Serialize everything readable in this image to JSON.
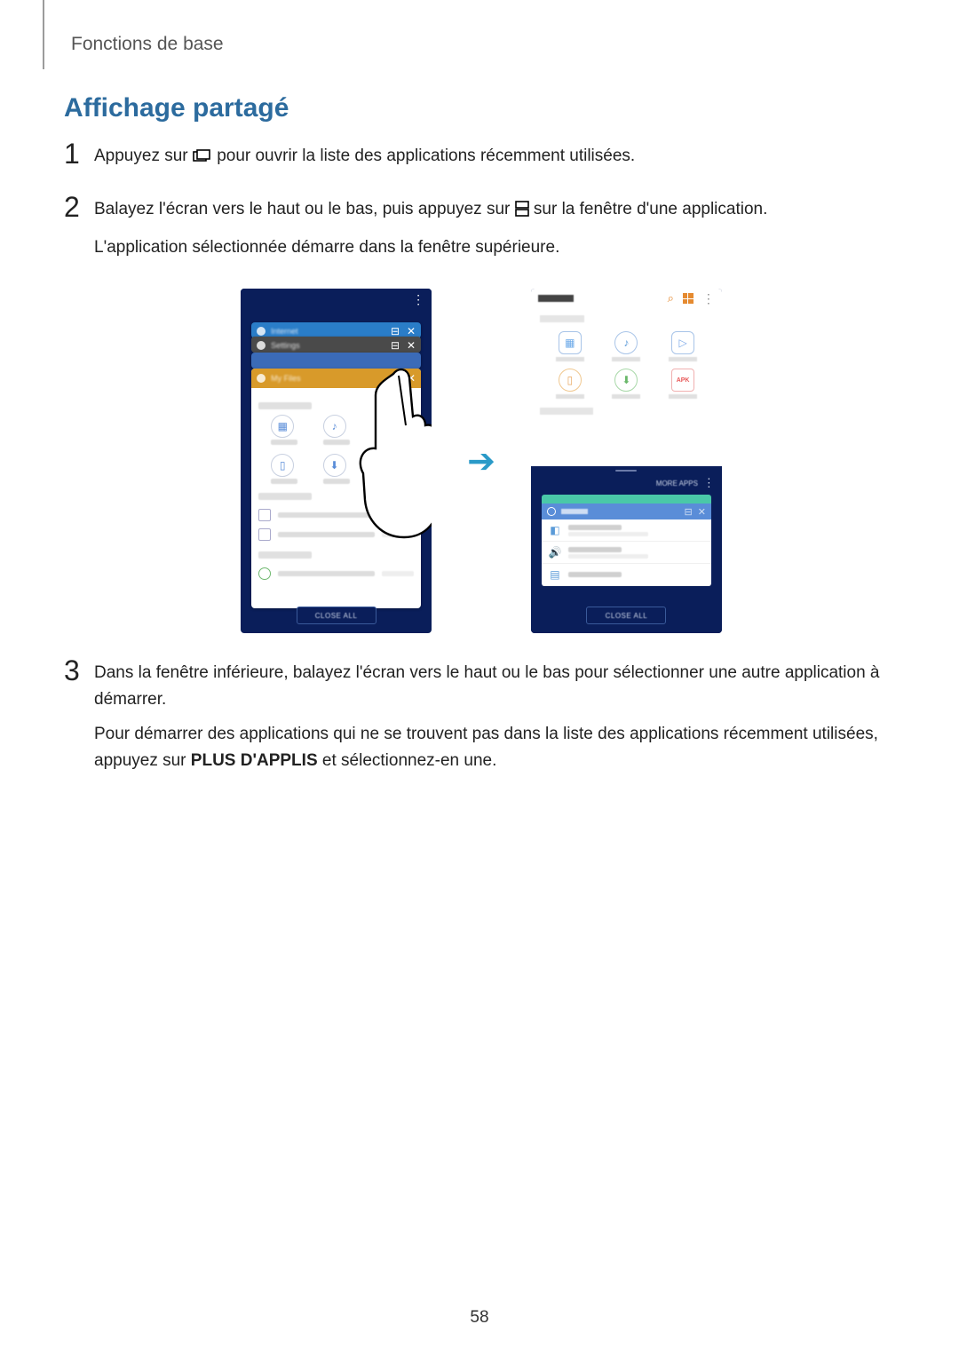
{
  "header": {
    "breadcrumb": "Fonctions de base"
  },
  "section": {
    "title": "Affichage partagé"
  },
  "steps": [
    {
      "num": "1",
      "text_before": "Appuyez sur ",
      "text_after": " pour ouvrir la liste des applications récemment utilisées."
    },
    {
      "num": "2",
      "line1_before": "Balayez l'écran vers le haut ou le bas, puis appuyez sur ",
      "line1_after": " sur la fenêtre d'une application.",
      "line2": "L'application sélectionnée démarre dans la fenêtre supérieure."
    },
    {
      "num": "3",
      "line1": "Dans la fenêtre inférieure, balayez l'écran vers le haut ou le bas pour sélectionner une autre application à démarrer.",
      "line2_before": "Pour démarrer des applications qui ne se trouvent pas dans la liste des applications récemment utilisées, appuyez sur ",
      "line2_bold": "PLUS D'APPLIS",
      "line2_after": " et sélectionnez-en une."
    }
  ],
  "figure": {
    "left_phone": {
      "cards": [
        "Internet",
        "Settings",
        "My Files"
      ],
      "close_all": "CLOSE ALL",
      "icons": [
        "image",
        "audio",
        "video",
        "doc",
        "download",
        "apk"
      ],
      "storage": [
        "Internal storage",
        "SD card",
        "Google Drive"
      ]
    },
    "right_phone": {
      "top_title": "MY FILES",
      "categories": [
        "Images",
        "Audio",
        "Videos",
        "Documents",
        "Downloads",
        "Installation files"
      ],
      "apk_label": "APK",
      "more_apps": "MORE APPS",
      "settings_rows": [
        "Connections",
        "Sounds and vibration",
        "Notifications"
      ],
      "close_all": "CLOSE ALL"
    }
  },
  "page_number": "58"
}
